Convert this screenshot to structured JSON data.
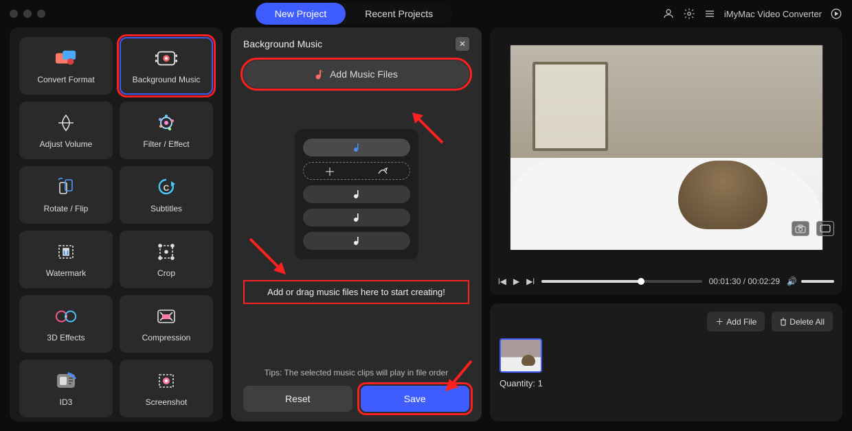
{
  "titlebar": {
    "tabs": {
      "new": "New Project",
      "recent": "Recent Projects"
    },
    "appName": "iMyMac Video Converter"
  },
  "tools": [
    {
      "id": "convert-format",
      "label": "Convert Format"
    },
    {
      "id": "background-music",
      "label": "Background Music"
    },
    {
      "id": "adjust-volume",
      "label": "Adjust Volume"
    },
    {
      "id": "filter-effect",
      "label": "Filter / Effect"
    },
    {
      "id": "rotate-flip",
      "label": "Rotate / Flip"
    },
    {
      "id": "subtitles",
      "label": "Subtitles"
    },
    {
      "id": "watermark",
      "label": "Watermark"
    },
    {
      "id": "crop",
      "label": "Crop"
    },
    {
      "id": "3d-effects",
      "label": "3D Effects"
    },
    {
      "id": "compression",
      "label": "Compression"
    },
    {
      "id": "id3",
      "label": "ID3"
    },
    {
      "id": "screenshot",
      "label": "Screenshot"
    }
  ],
  "center": {
    "title": "Background Music",
    "addButton": "Add Music Files",
    "hint": "Add or drag music files here to start creating!",
    "tips": "Tips: The selected music clips will play in file order",
    "reset": "Reset",
    "save": "Save"
  },
  "preview": {
    "currentTime": "00:01:30",
    "duration": "00:02:29"
  },
  "queue": {
    "addFile": "Add File",
    "deleteAll": "Delete All",
    "quantityLabel": "Quantity:",
    "quantityValue": "1"
  }
}
